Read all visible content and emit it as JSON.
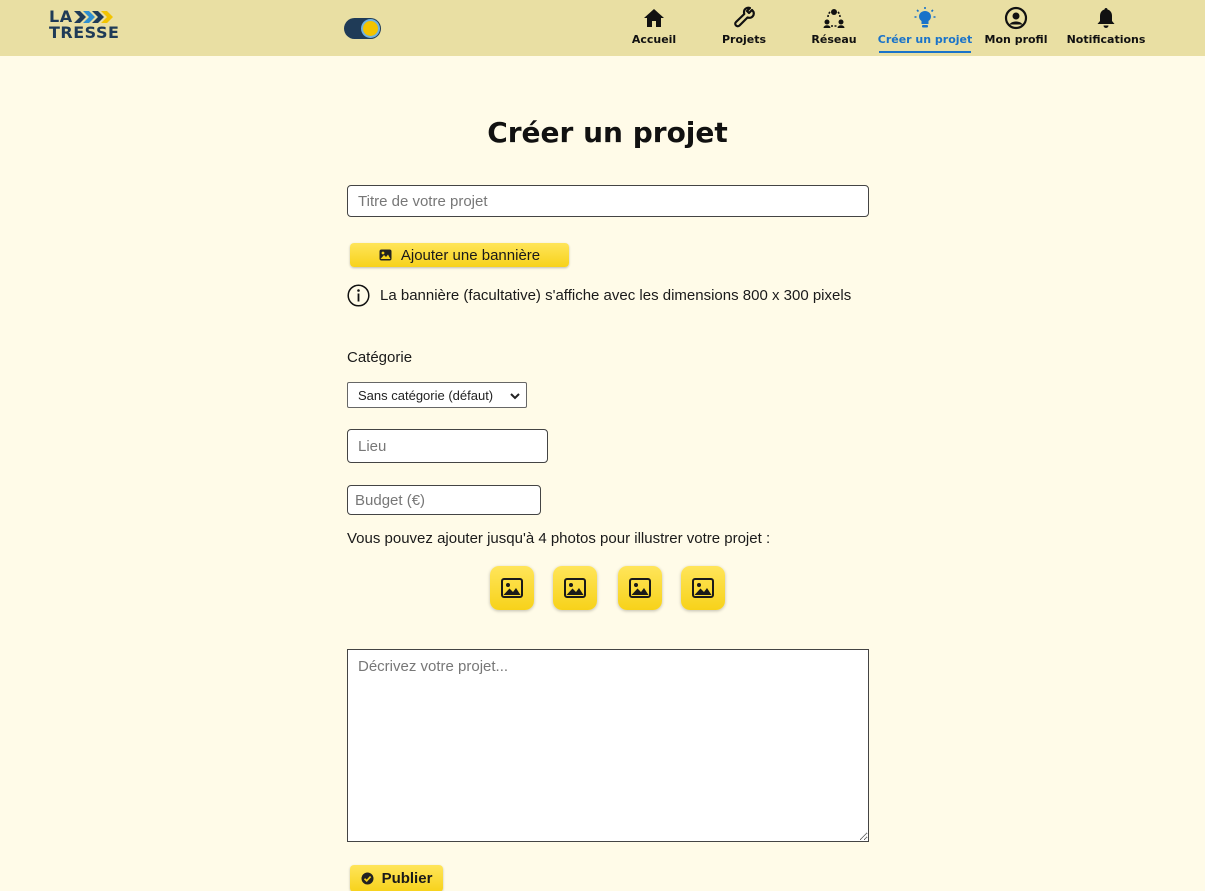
{
  "brand": {
    "logo_line1": "LA",
    "logo_line2": "TRESSE"
  },
  "nav": {
    "items": [
      {
        "label": "Accueil",
        "icon": "home-icon"
      },
      {
        "label": "Projets",
        "icon": "wrench-icon"
      },
      {
        "label": "Réseau",
        "icon": "network-icon"
      },
      {
        "label": "Créer un projet",
        "icon": "lightbulb-icon",
        "active": true
      },
      {
        "label": "Mon profil",
        "icon": "user-circle-icon"
      },
      {
        "label": "Notifications",
        "icon": "bell-icon"
      }
    ]
  },
  "colors": {
    "header_bg": "#e9dfa3",
    "page_bg": "#fffbe8",
    "accent_yellow": "#f7d21a",
    "active_blue": "#1a73c9",
    "navy": "#1f3b57"
  },
  "page": {
    "title": "Créer un projet"
  },
  "form": {
    "title_placeholder": "Titre de votre projet",
    "banner_button": "Ajouter une bannière",
    "banner_info": "La bannière (facultative) s'affiche avec les dimensions 800 x 300 pixels",
    "category_label": "Catégorie",
    "category_selected": "Sans catégorie (défaut)",
    "lieu_placeholder": "Lieu",
    "budget_placeholder": "Budget (€)",
    "photos_label": "Vous pouvez ajouter jusqu'à 4 photos pour illustrer votre projet :",
    "photo_slots": [
      "image-icon",
      "image-icon",
      "image-icon",
      "image-icon"
    ],
    "description_placeholder": "Décrivez votre projet...",
    "publish_button": "Publier"
  }
}
